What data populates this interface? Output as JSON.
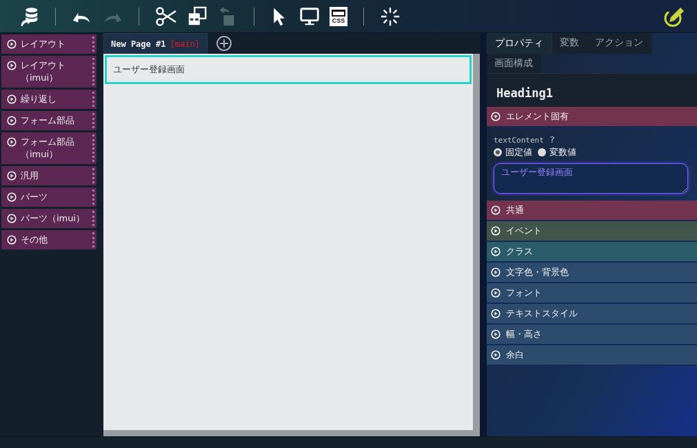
{
  "toolbar": {
    "groups": [
      {
        "buttons": [
          {
            "disabled": false
          }
        ]
      },
      {
        "buttons": [
          {
            "disabled": false
          },
          {
            "disabled": true
          }
        ]
      },
      {
        "buttons": [
          {
            "disabled": false
          },
          {
            "disabled": false
          },
          {
            "disabled": true
          }
        ]
      },
      {
        "buttons": [
          {
            "disabled": false
          },
          {
            "disabled": false
          },
          {
            "disabled": false,
            "label": "CSS"
          }
        ]
      },
      {
        "buttons": [
          {
            "disabled": false
          }
        ]
      }
    ]
  },
  "palette": {
    "items": [
      {
        "label": "レイアウト"
      },
      {
        "label": "レイアウト（imui）"
      },
      {
        "label": "繰り返し"
      },
      {
        "label": "フォーム部品"
      },
      {
        "label": "フォーム部品（imui）"
      },
      {
        "label": "汎用"
      },
      {
        "label": "パーツ"
      },
      {
        "label": "パーツ（imui）"
      },
      {
        "label": "その他"
      }
    ]
  },
  "page_tabs": [
    {
      "label": "New Page #1",
      "tag": "[main]",
      "selected": true
    }
  ],
  "canvas": {
    "elements": [
      {
        "text": "ユーザー登録画面",
        "selected": true
      }
    ]
  },
  "panel": {
    "tabs": [
      {
        "label": "プロパティ",
        "selected": true
      },
      {
        "label": "変数",
        "selected": false
      },
      {
        "label": "アクション",
        "selected": false
      },
      {
        "label": "画面構成",
        "selected": false
      }
    ],
    "element_name": "Heading1",
    "sections": [
      {
        "label": "エレメント固有",
        "expanded": true,
        "color": "#74334d"
      },
      {
        "label": "共通",
        "expanded": false,
        "color": "#74334f"
      },
      {
        "label": "イベント",
        "expanded": false,
        "color": "#41554b"
      },
      {
        "label": "クラス",
        "expanded": false,
        "color": "#2b5c6a"
      },
      {
        "label": "文字色・背景色",
        "expanded": false,
        "color": "#2d4c6d"
      },
      {
        "label": "フォント",
        "expanded": false,
        "color": "#2d4c6d"
      },
      {
        "label": "テキストスタイル",
        "expanded": false,
        "color": "#2d4c6d"
      },
      {
        "label": "幅・高さ",
        "expanded": false,
        "color": "#2d4c6d"
      },
      {
        "label": "余白",
        "expanded": false,
        "color": "#2d4c6d"
      }
    ],
    "property": {
      "name": "textContent",
      "help": "?",
      "options": [
        {
          "label": "固定値",
          "selected": true
        },
        {
          "label": "変数値",
          "selected": false
        }
      ],
      "value": "ユーザー登録画面"
    }
  }
}
